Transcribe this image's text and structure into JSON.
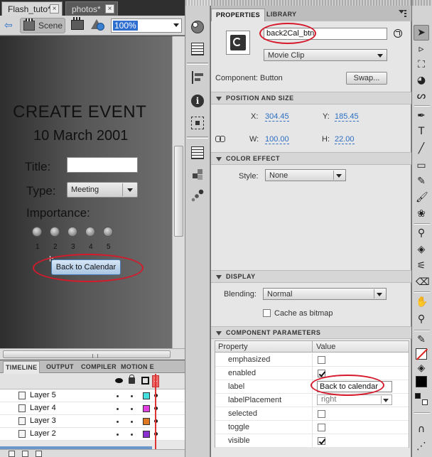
{
  "doc_tabs": [
    {
      "label": "Flash_tuto*",
      "active": true
    },
    {
      "label": "photos*",
      "active": false
    }
  ],
  "edit_bar": {
    "scene_label": "Scene",
    "zoom_value": "100%"
  },
  "stage": {
    "title": "CREATE EVENT",
    "date": "10  March 2001",
    "title_label": "Title:",
    "type_label": "Type:",
    "type_value": "Meeting",
    "importance_label": "Importance:",
    "importance_levels": [
      "1",
      "2",
      "3",
      "4",
      "5"
    ],
    "button_label": "Back to Calendar"
  },
  "timeline": {
    "tabs": [
      "TIMELINE",
      "OUTPUT",
      "COMPILER",
      "MOTION E"
    ],
    "frame_number": "1",
    "layers": [
      {
        "name": "Layer 5",
        "color": "#44e0e0"
      },
      {
        "name": "Layer 4",
        "color": "#e040e0"
      },
      {
        "name": "Layer 3",
        "color": "#e07a20"
      },
      {
        "name": "Layer 2",
        "color": "#8a2fd0"
      }
    ]
  },
  "properties": {
    "tabs": [
      "PROPERTIES",
      "LIBRARY"
    ],
    "instance_name": "back2Cal_btn",
    "symbol_type": "Movie Clip",
    "component_label": "Component:",
    "component_value": "Button",
    "swap_label": "Swap...",
    "sections": {
      "position_size": "POSITION AND SIZE",
      "color_effect": "COLOR EFFECT",
      "display": "DISPLAY",
      "component_params": "COMPONENT PARAMETERS"
    },
    "position": {
      "x_label": "X:",
      "x_value": "304.45",
      "y_label": "Y:",
      "y_value": "185.45",
      "w_label": "W:",
      "w_value": "100.00",
      "h_label": "H:",
      "h_value": "22.00"
    },
    "style_label": "Style:",
    "style_value": "None",
    "blending_label": "Blending:",
    "blending_value": "Normal",
    "cache_label": "Cache as bitmap",
    "params_header": {
      "property": "Property",
      "value": "Value"
    },
    "params": [
      {
        "property": "emphasized",
        "kind": "checkbox",
        "checked": false
      },
      {
        "property": "enabled",
        "kind": "checkbox",
        "checked": true
      },
      {
        "property": "label",
        "kind": "text",
        "value": "Back to calendar"
      },
      {
        "property": "labelPlacement",
        "kind": "select",
        "value": "right"
      },
      {
        "property": "selected",
        "kind": "checkbox",
        "checked": false
      },
      {
        "property": "toggle",
        "kind": "checkbox",
        "checked": false
      },
      {
        "property": "visible",
        "kind": "checkbox",
        "checked": true
      }
    ]
  },
  "tools": {
    "text_tool_glyph": "T"
  },
  "colors": {
    "annotation": "#d6192b",
    "link": "#2b6ec4",
    "zoom_highlight": "#2f6fd0"
  }
}
